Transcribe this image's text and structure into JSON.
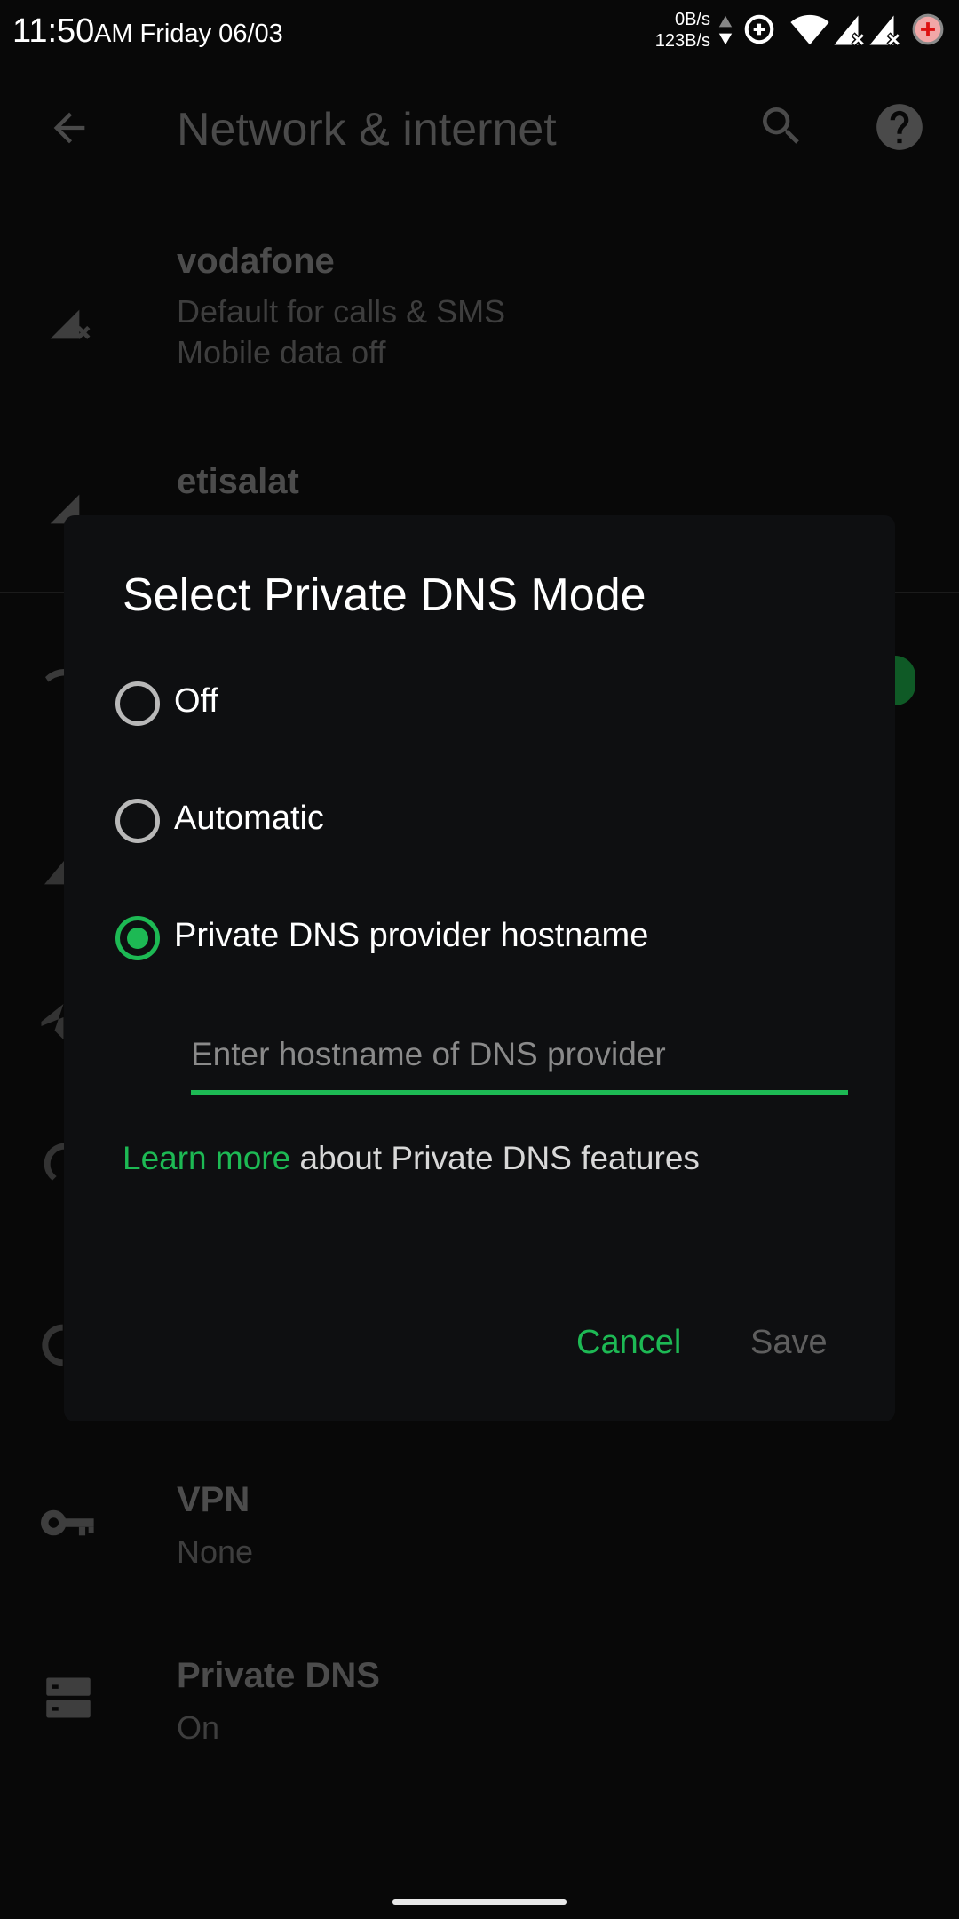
{
  "status_bar": {
    "time": "11:50",
    "ampm_day": "AM Friday 06/03",
    "upload_speed": "0B/s",
    "download_speed": "123B/s",
    "icons": [
      "net-activity-arrows-icon",
      "data-saver-icon",
      "wifi-icon",
      "signal-x-icon",
      "signal-x-icon",
      "battery-charging-icon"
    ]
  },
  "background_screen": {
    "title": "Network & internet",
    "icons": [
      "back-arrow-icon",
      "search-icon",
      "help-icon"
    ],
    "items": [
      {
        "title": "vodafone",
        "subtitle_1": "Default for calls & SMS",
        "subtitle_2": "Mobile data off",
        "icon": "signal-x-icon"
      },
      {
        "title": "etisalat",
        "icon": "signal-x-icon"
      },
      {
        "title": "VPN",
        "subtitle": "None",
        "icon": "key-icon"
      },
      {
        "title": "Private DNS",
        "subtitle": "On",
        "icon": "dns-icon"
      }
    ]
  },
  "dialog": {
    "title": "Select Private DNS Mode",
    "options": [
      {
        "label": "Off",
        "checked": false
      },
      {
        "label": "Automatic",
        "checked": false
      },
      {
        "label": "Private DNS provider hostname",
        "checked": true
      }
    ],
    "hostname_input": {
      "value": "",
      "placeholder": "Enter hostname of DNS provider"
    },
    "learn_more_link": "Learn more",
    "learn_more_rest": " about Private DNS features",
    "cancel_label": "Cancel",
    "save_label": "Save"
  },
  "colors": {
    "accent": "#1db954",
    "dialog_background": "#0e0f11",
    "disabled_text": "#5e5e5e"
  }
}
